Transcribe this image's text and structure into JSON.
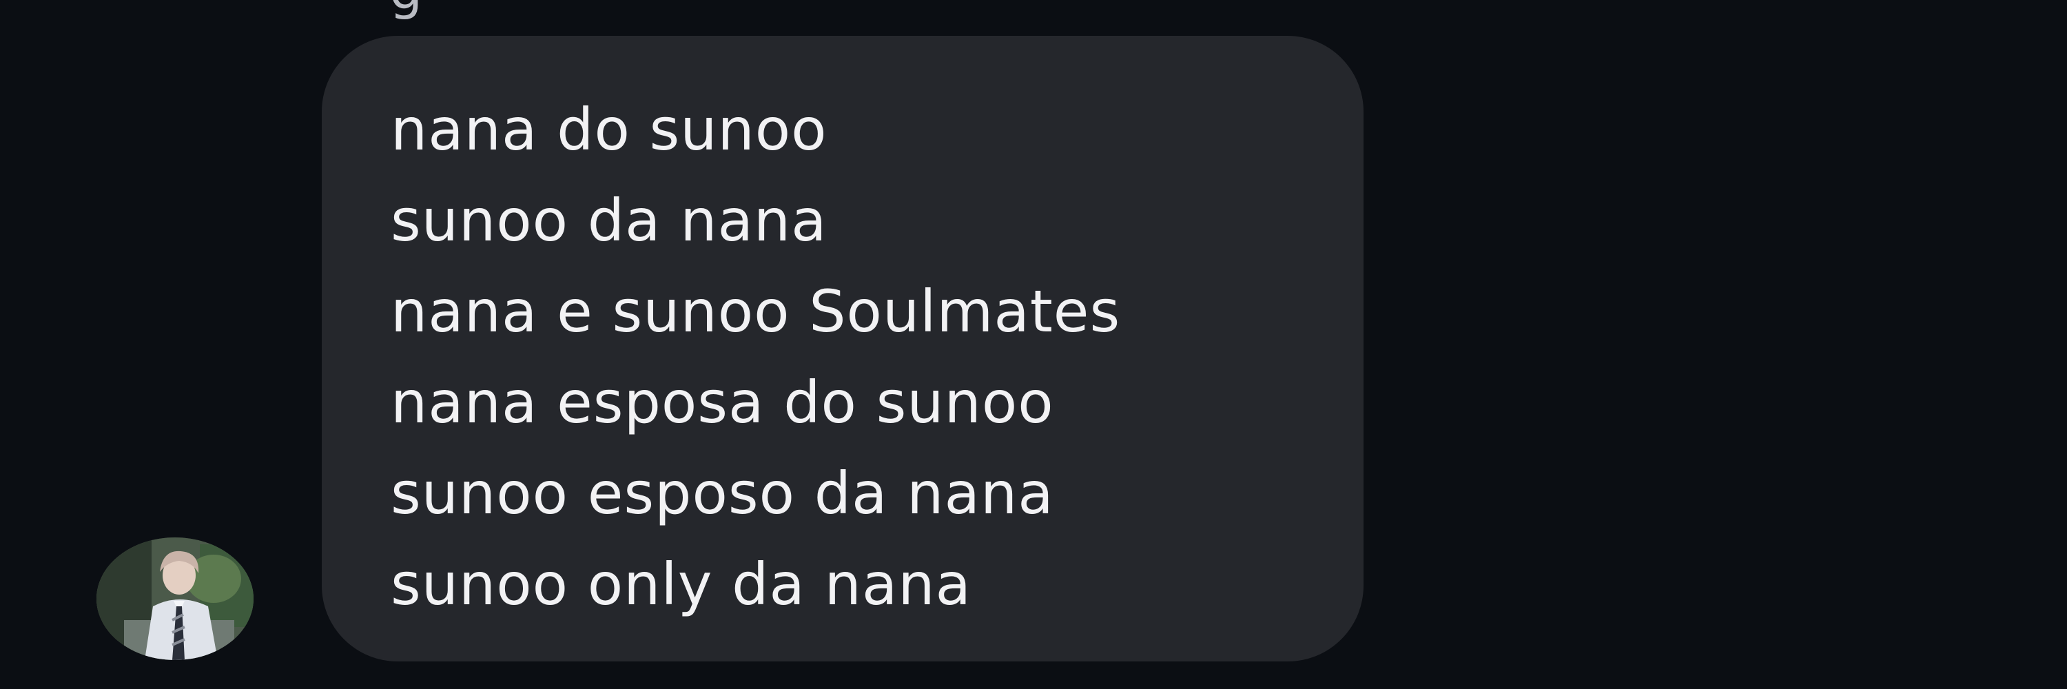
{
  "conversation": {
    "previous_message_tail": "g",
    "message": {
      "lines": [
        "nana do sunoo",
        "sunoo da nana",
        "nana e sunoo Soulmates",
        "nana esposa do sunoo",
        "sunoo esposo da nana",
        "sunoo only da nana"
      ]
    }
  },
  "colors": {
    "background": "#0b0e13",
    "bubble": "#25272c",
    "text": "#f2f2f4"
  }
}
